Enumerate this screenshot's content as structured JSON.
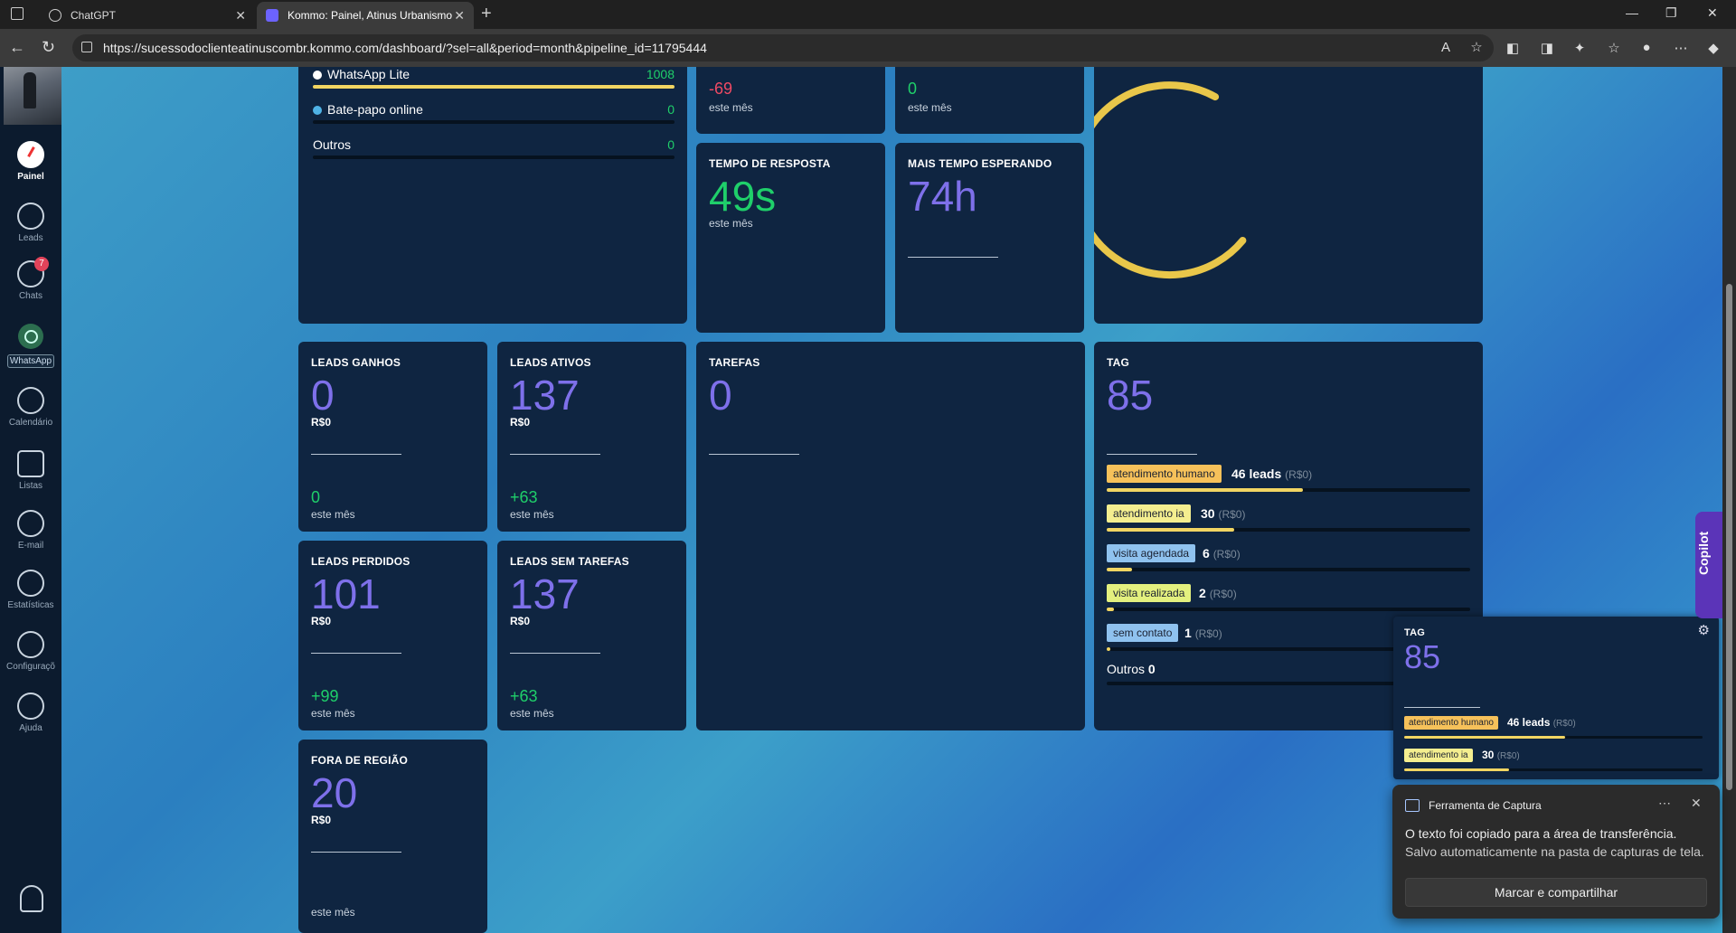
{
  "browser": {
    "tabs": [
      {
        "label": "ChatGPT"
      },
      {
        "label": "Kommo: Painel, Atinus Urbanismo"
      }
    ],
    "url": "https://sucessodoclienteatinuscombr.kommo.com/dashboard/?sel=all&period=month&pipeline_id=11795444"
  },
  "sidebar": {
    "items": [
      {
        "label": "Painel"
      },
      {
        "label": "Leads"
      },
      {
        "label": "Chats",
        "badge": "7"
      },
      {
        "label": "WhatsApp"
      },
      {
        "label": "Calendário"
      },
      {
        "label": "Listas"
      },
      {
        "label": "E-mail"
      },
      {
        "label": "Estatísticas"
      },
      {
        "label": "Configuraçõ"
      },
      {
        "label": "Ajuda"
      }
    ]
  },
  "sources": {
    "rows": [
      {
        "name": "WhatsApp Lite",
        "value": "1008",
        "share": 1.0
      },
      {
        "name": "Bate-papo online",
        "value": "0",
        "share": 0
      },
      {
        "name": "Outros",
        "value": "0",
        "share": 0
      }
    ]
  },
  "top_cards": {
    "card_a": {
      "delta": "-69",
      "sub": "este mês"
    },
    "card_b": {
      "delta": "0",
      "sub": "este mês"
    }
  },
  "response_time": {
    "title": "TEMPO DE RESPOSTA",
    "value": "49s",
    "sub": "este mês"
  },
  "longest_wait": {
    "title": "MAIS TEMPO ESPERANDO",
    "value": "74h"
  },
  "leads_ganhos": {
    "title": "LEADS GANHOS",
    "value": "0",
    "money": "R$0",
    "delta": "0",
    "sub": "este mês"
  },
  "leads_ativos": {
    "title": "LEADS ATIVOS",
    "value": "137",
    "money": "R$0",
    "delta": "+63",
    "sub": "este mês"
  },
  "tarefas": {
    "title": "TAREFAS",
    "value": "0"
  },
  "leads_perdidos": {
    "title": "LEADS PERDIDOS",
    "value": "101",
    "money": "R$0",
    "delta": "+99",
    "sub": "este mês"
  },
  "leads_sem_tarefas": {
    "title": "LEADS SEM TAREFAS",
    "value": "137",
    "money": "R$0",
    "delta": "+63",
    "sub": "este mês"
  },
  "fora_regiao": {
    "title": "FORA DE REGIÃO",
    "value": "20",
    "money": "R$0",
    "sub": "este mês"
  },
  "tag_card": {
    "title": "TAG",
    "value": "85",
    "rows": [
      {
        "label": "atendimento humano",
        "count": "46 leads",
        "money": "(R$0)",
        "color": "#f6c15a",
        "share": 0.54
      },
      {
        "label": "atendimento ia",
        "count": "30",
        "money": "(R$0)",
        "color": "#f4ee8f",
        "share": 0.35
      },
      {
        "label": "visita agendada",
        "count": "6",
        "money": "(R$0)",
        "color": "#8fc2ef",
        "share": 0.07
      },
      {
        "label": "visita realizada",
        "count": "2",
        "money": "(R$0)",
        "color": "#e3f07e",
        "share": 0.02
      },
      {
        "label": "sem contato",
        "count": "1",
        "money": "(R$0)",
        "color": "#8fc2ef",
        "share": 0.01
      }
    ],
    "others_label": "Outros",
    "others_value": "0"
  },
  "tag_popup": {
    "title": "TAG",
    "value": "85",
    "rows": [
      {
        "label": "atendimento humano",
        "count": "46 leads",
        "money": "(R$0)",
        "color": "#f6c15a",
        "share": 0.54
      },
      {
        "label": "atendimento ia",
        "count": "30",
        "money": "(R$0)",
        "color": "#f4ee8f",
        "share": 0.35
      }
    ]
  },
  "gauge": {
    "color": "#e9c74a",
    "fill_fraction": 0.72
  },
  "notification": {
    "app": "Ferramenta de Captura",
    "line1": "O texto foi copiado para a área de transferência.",
    "line2": "Salvo automaticamente na pasta de capturas de tela.",
    "button": "Marcar e compartilhar"
  },
  "copilot": {
    "label": "Copilot"
  },
  "colors": {
    "accent_purple": "#7e70ea",
    "green": "#1fcf6a",
    "red": "#f04a64",
    "card_bg": "#0f2541"
  }
}
